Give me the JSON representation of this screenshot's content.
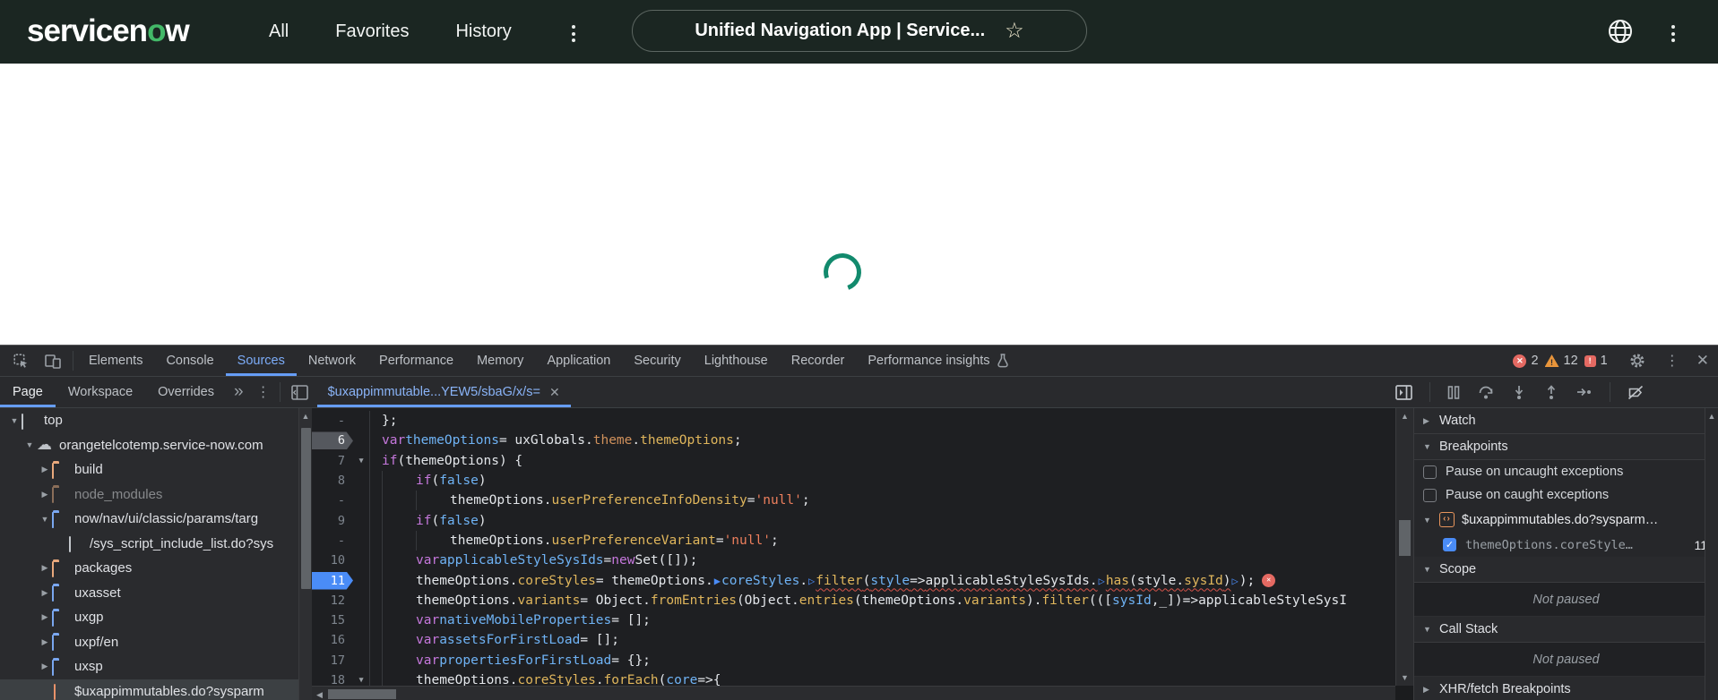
{
  "colors": {
    "topbar_bg": "#1b2622",
    "brand_green": "#43b868",
    "accent_blue": "#669df6",
    "spinner_green": "#128a6d",
    "toolbar_bg": "#292a2d",
    "editor_bg": "#1e1f22",
    "error_red": "#e46962",
    "warning_orange": "#e8953b"
  },
  "topbar": {
    "logo": {
      "pre": "servicen",
      "o": "o",
      "post": "w"
    },
    "nav_items": [
      {
        "label": "All"
      },
      {
        "label": "Favorites"
      },
      {
        "label": "History"
      }
    ],
    "title_pill": {
      "text": "Unified Navigation App | Service...",
      "star": "☆"
    }
  },
  "devtools": {
    "main_tabs": [
      {
        "label": "Elements"
      },
      {
        "label": "Console"
      },
      {
        "label": "Sources",
        "active": true
      },
      {
        "label": "Network"
      },
      {
        "label": "Performance"
      },
      {
        "label": "Memory"
      },
      {
        "label": "Application"
      },
      {
        "label": "Security"
      },
      {
        "label": "Lighthouse"
      },
      {
        "label": "Recorder"
      },
      {
        "label": "Performance insights",
        "flask": true
      }
    ],
    "badges": {
      "errors": "2",
      "warnings": "12",
      "issues": "1"
    },
    "source_tabs": [
      {
        "label": "Page",
        "active": true
      },
      {
        "label": "Workspace"
      },
      {
        "label": "Overrides"
      }
    ],
    "more_tabs_chevron": "»",
    "file_tab": {
      "label": "$uxappimmutable...YEW5/sbaG/x/s=",
      "close": "✕"
    },
    "tree": [
      {
        "label": "top",
        "icon": "frame",
        "arrow": "open",
        "ind": 0
      },
      {
        "label": "orangetelcotemp.service-now.com",
        "icon": "cloud",
        "arrow": "open",
        "ind": 1
      },
      {
        "label": "build",
        "icon": "folder-orange",
        "arrow": "closed",
        "ind": 2
      },
      {
        "label": "node_modules",
        "icon": "folder-dim",
        "arrow": "closed",
        "ind": 2,
        "dim": true
      },
      {
        "label": "now/nav/ui/classic/params/targ",
        "icon": "folder-blue-open",
        "arrow": "open",
        "ind": 2
      },
      {
        "label": "/sys_script_include_list.do?sys",
        "icon": "file",
        "arrow": "none",
        "ind": 3
      },
      {
        "label": "packages",
        "icon": "folder-orange",
        "arrow": "closed",
        "ind": 2
      },
      {
        "label": "uxasset",
        "icon": "folder-blue",
        "arrow": "closed",
        "ind": 2
      },
      {
        "label": "uxgp",
        "icon": "folder-blue",
        "arrow": "closed",
        "ind": 2
      },
      {
        "label": "uxpf/en",
        "icon": "folder-blue",
        "arrow": "closed",
        "ind": 2
      },
      {
        "label": "uxsp",
        "icon": "folder-blue",
        "arrow": "closed",
        "ind": 2
      },
      {
        "label": "$uxappimmutables.do?sysparm",
        "icon": "file-orange",
        "arrow": "none",
        "ind": 2,
        "selected": true
      }
    ],
    "code_lines": [
      {
        "n": "-",
        "ind": 0,
        "tokens": [
          [
            "t",
            "};"
          ]
        ]
      },
      {
        "n": "6",
        "ind": 0,
        "mark": "gray",
        "tokens": [
          [
            "k",
            "var"
          ],
          [
            "t",
            " "
          ],
          [
            "v",
            "themeOptions"
          ],
          [
            "t",
            " = uxGlobals."
          ],
          [
            "po",
            "theme"
          ],
          [
            "t",
            "."
          ],
          [
            "p",
            "themeOptions"
          ],
          [
            "t",
            ";"
          ]
        ]
      },
      {
        "n": "7",
        "ind": 0,
        "fold": true,
        "tokens": [
          [
            "k",
            "if"
          ],
          [
            "t",
            " (themeOptions) {"
          ]
        ]
      },
      {
        "n": "8",
        "ind": 1,
        "tokens": [
          [
            "k",
            "if"
          ],
          [
            "t",
            " ("
          ],
          [
            "a",
            "false"
          ],
          [
            "t",
            ")"
          ]
        ]
      },
      {
        "n": "-",
        "ind": 2,
        "tokens": [
          [
            "t",
            "themeOptions."
          ],
          [
            "p",
            "userPreferenceInfoDensity"
          ],
          [
            "t",
            " = "
          ],
          [
            "s",
            "'null'"
          ],
          [
            "t",
            ";"
          ]
        ]
      },
      {
        "n": "9",
        "ind": 1,
        "tokens": [
          [
            "k",
            "if"
          ],
          [
            "t",
            " ("
          ],
          [
            "a",
            "false"
          ],
          [
            "t",
            ")"
          ]
        ]
      },
      {
        "n": "-",
        "ind": 2,
        "tokens": [
          [
            "t",
            "themeOptions."
          ],
          [
            "p",
            "userPreferenceVariant"
          ],
          [
            "t",
            " = "
          ],
          [
            "s",
            "'null'"
          ],
          [
            "t",
            ";"
          ]
        ]
      },
      {
        "n": "10",
        "ind": 1,
        "tokens": [
          [
            "k",
            "var"
          ],
          [
            "t",
            " "
          ],
          [
            "v",
            "applicableStyleSysIds"
          ],
          [
            "t",
            " = "
          ],
          [
            "k",
            "new"
          ],
          [
            "t",
            " Set([]);"
          ]
        ]
      },
      {
        "n": "11",
        "ind": 1,
        "mark": "blue",
        "tokens": [
          [
            "t",
            "themeOptions."
          ],
          [
            "p",
            "coreStyles"
          ],
          [
            "t",
            " = themeOptions."
          ],
          [
            "m",
            "▶"
          ],
          [
            "v",
            "coreStyles"
          ],
          [
            "t",
            "."
          ],
          [
            "mo",
            "▷"
          ],
          [
            "p e",
            "filter"
          ],
          [
            "t e",
            "("
          ],
          [
            "v e",
            "style"
          ],
          [
            "t e",
            "=>"
          ],
          [
            "t e",
            "applicableStyleSysIds."
          ],
          [
            "mo",
            "▷"
          ],
          [
            "p e",
            "has"
          ],
          [
            "t e",
            "(style."
          ],
          [
            "p e",
            "sysId"
          ],
          [
            "t e",
            ")"
          ],
          [
            "mo",
            "▷"
          ],
          [
            "t",
            ");"
          ],
          [
            "x",
            ""
          ]
        ]
      },
      {
        "n": "12",
        "ind": 1,
        "tokens": [
          [
            "t",
            "themeOptions."
          ],
          [
            "p",
            "variants"
          ],
          [
            "t",
            " = Object."
          ],
          [
            "p",
            "fromEntries"
          ],
          [
            "t",
            "(Object."
          ],
          [
            "p",
            "entries"
          ],
          [
            "t",
            "(themeOptions."
          ],
          [
            "p",
            "variants"
          ],
          [
            "t",
            ")."
          ],
          [
            "p",
            "filter"
          ],
          [
            "t",
            "((["
          ],
          [
            "v",
            "sysId"
          ],
          [
            "t",
            ",_])=>applicableStyleSysI"
          ]
        ]
      },
      {
        "n": "15",
        "ind": 1,
        "tokens": [
          [
            "k",
            "var"
          ],
          [
            "t",
            " "
          ],
          [
            "v",
            "nativeMobileProperties"
          ],
          [
            "t",
            " = [];"
          ]
        ]
      },
      {
        "n": "16",
        "ind": 1,
        "tokens": [
          [
            "k",
            "var"
          ],
          [
            "t",
            " "
          ],
          [
            "v",
            "assetsForFirstLoad"
          ],
          [
            "t",
            " = [];"
          ]
        ]
      },
      {
        "n": "17",
        "ind": 1,
        "tokens": [
          [
            "k",
            "var"
          ],
          [
            "t",
            " "
          ],
          [
            "v",
            "propertiesForFirstLoad"
          ],
          [
            "t",
            " = {};"
          ]
        ]
      },
      {
        "n": "18",
        "ind": 1,
        "fold": true,
        "tokens": [
          [
            "t",
            "themeOptions."
          ],
          [
            "p",
            "coreStyles"
          ],
          [
            "t",
            "."
          ],
          [
            "p",
            "forEach"
          ],
          [
            "t",
            "("
          ],
          [
            "v",
            "core"
          ],
          [
            "t",
            "=>{"
          ]
        ]
      }
    ],
    "sidebar": [
      {
        "type": "header",
        "label": "Watch",
        "arrow": "closed"
      },
      {
        "type": "header",
        "label": "Breakpoints",
        "arrow": "open"
      },
      {
        "type": "checkbox",
        "label": "Pause on uncaught exceptions",
        "checked": false
      },
      {
        "type": "checkbox",
        "label": "Pause on caught exceptions",
        "checked": false
      },
      {
        "type": "bp-group",
        "label": "$uxappimmutables.do?sysparm…",
        "arrow": "open"
      },
      {
        "type": "bp-entry",
        "label": "themeOptions.coreStyle…",
        "line": "11",
        "checked": true
      },
      {
        "type": "header",
        "label": "Scope",
        "arrow": "open"
      },
      {
        "type": "empty",
        "label": "Not paused"
      },
      {
        "type": "header",
        "label": "Call Stack",
        "arrow": "open"
      },
      {
        "type": "empty",
        "label": "Not paused"
      },
      {
        "type": "header",
        "label": "XHR/fetch Breakpoints",
        "arrow": "closed"
      }
    ]
  }
}
